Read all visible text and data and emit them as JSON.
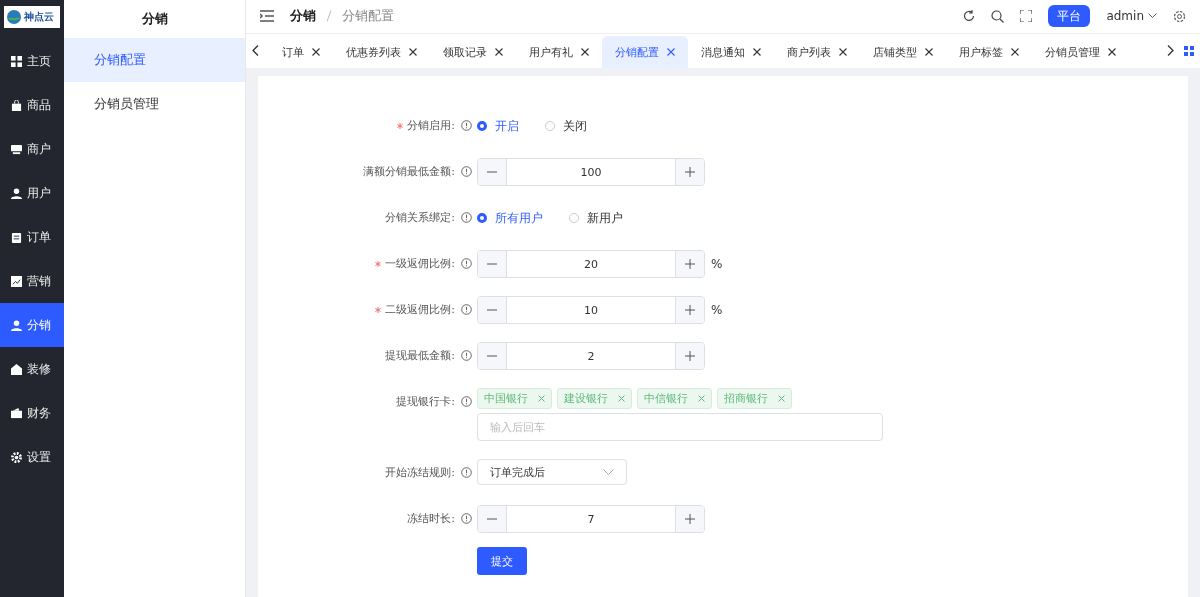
{
  "logo": {
    "text": "神点云"
  },
  "nav": [
    {
      "label": "主页",
      "selected": false
    },
    {
      "label": "商品",
      "selected": false
    },
    {
      "label": "商户",
      "selected": false
    },
    {
      "label": "用户",
      "selected": false
    },
    {
      "label": "订单",
      "selected": false
    },
    {
      "label": "营销",
      "selected": false
    },
    {
      "label": "分销",
      "selected": true
    },
    {
      "label": "装修",
      "selected": false
    },
    {
      "label": "财务",
      "selected": false
    },
    {
      "label": "设置",
      "selected": false
    }
  ],
  "submenu": {
    "title": "分销",
    "items": [
      {
        "label": "分销配置",
        "selected": true
      },
      {
        "label": "分销员管理",
        "selected": false
      }
    ]
  },
  "breadcrumb": [
    "分销",
    "分销配置"
  ],
  "header": {
    "platform_button": "平台",
    "user": "admin"
  },
  "tabs": [
    {
      "label": "订单",
      "selected": false
    },
    {
      "label": "优惠券列表",
      "selected": false
    },
    {
      "label": "领取记录",
      "selected": false
    },
    {
      "label": "用户有礼",
      "selected": false
    },
    {
      "label": "分销配置",
      "selected": true
    },
    {
      "label": "消息通知",
      "selected": false
    },
    {
      "label": "商户列表",
      "selected": false
    },
    {
      "label": "店铺类型",
      "selected": false
    },
    {
      "label": "用户标签",
      "selected": false
    },
    {
      "label": "分销员管理",
      "selected": false
    }
  ],
  "form": [
    {
      "kind": "radio",
      "label": "分销启用:",
      "required": true,
      "options": [
        {
          "label": "开启",
          "selected": true
        },
        {
          "label": "关闭",
          "selected": false
        }
      ]
    },
    {
      "kind": "number",
      "label": "满额分销最低金额:",
      "required": false,
      "value": "100"
    },
    {
      "kind": "radio",
      "label": "分销关系绑定:",
      "required": false,
      "options": [
        {
          "label": "所有用户",
          "selected": true
        },
        {
          "label": "新用户",
          "selected": false
        }
      ]
    },
    {
      "kind": "number",
      "label": "一级返佣比例:",
      "required": true,
      "value": "20",
      "suffix": "%"
    },
    {
      "kind": "number",
      "label": "二级返佣比例:",
      "required": true,
      "value": "10",
      "suffix": "%"
    },
    {
      "kind": "number",
      "label": "提现最低金额:",
      "required": false,
      "value": "2"
    },
    {
      "kind": "tags",
      "label": "提现银行卡:",
      "required": false,
      "tags": [
        "中国银行",
        "建设银行",
        "中信银行",
        "招商银行"
      ],
      "placeholder": "输入后回车"
    },
    {
      "kind": "select",
      "label": "开始冻结规则:",
      "required": false,
      "value": "订单完成后"
    },
    {
      "kind": "number",
      "label": "冻结时长:",
      "required": false,
      "value": "7"
    }
  ],
  "submit": "提交"
}
